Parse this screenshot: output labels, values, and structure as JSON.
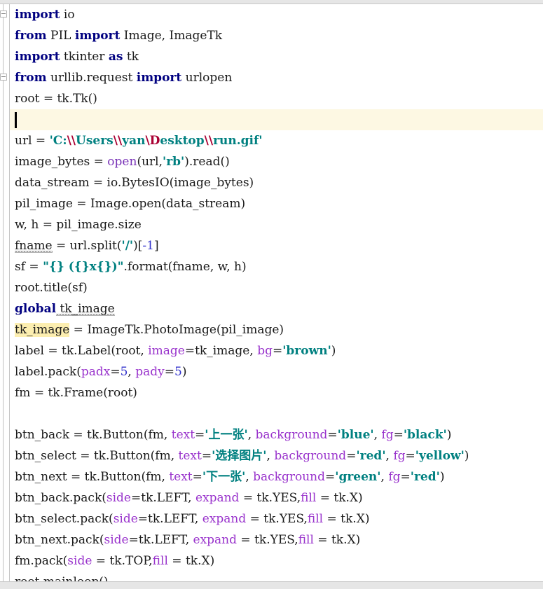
{
  "editor": {
    "language": "python",
    "background_color": "#ffffff",
    "text_color": "#1a1a1a",
    "current_line_color": "#fdf8e3",
    "occurrence_highlight_color": "#fceeb0",
    "keyword_color": "#000080",
    "string_color": "#008080",
    "escape_color": "#aa0033",
    "builtin_color": "#7a34b8",
    "kwarg_color": "#9933cc",
    "number_color": "#3333cc",
    "caret": {
      "line_index": 5,
      "column": 0
    }
  },
  "gutter": {
    "fold_markers": [
      {
        "line_index": 0,
        "state": "expanded",
        "icon": "fold-minus-icon"
      },
      {
        "line_index": 3,
        "state": "expanded",
        "icon": "fold-minus-icon"
      }
    ]
  },
  "code_lines": [
    {
      "index": 0,
      "current": false,
      "tokens": [
        {
          "t": "import",
          "c": "kw"
        },
        {
          "t": " io",
          "c": "plain"
        }
      ]
    },
    {
      "index": 1,
      "current": false,
      "tokens": [
        {
          "t": "from",
          "c": "kw"
        },
        {
          "t": " PIL ",
          "c": "plain"
        },
        {
          "t": "import",
          "c": "kw"
        },
        {
          "t": " Image, ImageTk",
          "c": "plain"
        }
      ]
    },
    {
      "index": 2,
      "current": false,
      "tokens": [
        {
          "t": "import",
          "c": "kw"
        },
        {
          "t": " tkinter ",
          "c": "plain"
        },
        {
          "t": "as",
          "c": "kw"
        },
        {
          "t": " tk",
          "c": "plain"
        }
      ]
    },
    {
      "index": 3,
      "current": false,
      "tokens": [
        {
          "t": "from",
          "c": "kw"
        },
        {
          "t": " urllib.request ",
          "c": "plain"
        },
        {
          "t": "import",
          "c": "kw"
        },
        {
          "t": " urlopen",
          "c": "plain"
        }
      ]
    },
    {
      "index": 4,
      "current": false,
      "tokens": [
        {
          "t": "root = tk.Tk()",
          "c": "plain"
        }
      ]
    },
    {
      "index": 5,
      "current": true,
      "tokens": []
    },
    {
      "index": 6,
      "current": false,
      "tokens": [
        {
          "t": "url = ",
          "c": "plain"
        },
        {
          "t": "'C:",
          "c": "str"
        },
        {
          "t": "\\\\",
          "c": "esc"
        },
        {
          "t": "Users",
          "c": "str"
        },
        {
          "t": "\\\\",
          "c": "esc"
        },
        {
          "t": "yan",
          "c": "str"
        },
        {
          "t": "\\D",
          "c": "esc"
        },
        {
          "t": "esktop",
          "c": "str"
        },
        {
          "t": "\\\\",
          "c": "esc"
        },
        {
          "t": "run.gif'",
          "c": "str"
        }
      ]
    },
    {
      "index": 7,
      "current": false,
      "tokens": [
        {
          "t": "image_bytes = ",
          "c": "plain"
        },
        {
          "t": "open",
          "c": "builtin"
        },
        {
          "t": "(url,",
          "c": "plain"
        },
        {
          "t": "'rb'",
          "c": "str"
        },
        {
          "t": ").read()",
          "c": "plain"
        }
      ]
    },
    {
      "index": 8,
      "current": false,
      "tokens": [
        {
          "t": "data_stream = io.BytesIO(image_bytes)",
          "c": "plain"
        }
      ]
    },
    {
      "index": 9,
      "current": false,
      "tokens": [
        {
          "t": "pil_image = Image.open(data_stream)",
          "c": "plain"
        }
      ]
    },
    {
      "index": 10,
      "current": false,
      "tokens": [
        {
          "t": "w, h = pil_image.size",
          "c": "plain"
        }
      ]
    },
    {
      "index": 11,
      "current": false,
      "tokens": [
        {
          "t": "fname",
          "c": "plain",
          "squiggly": true
        },
        {
          "t": " = url.split(",
          "c": "plain"
        },
        {
          "t": "'/'",
          "c": "str"
        },
        {
          "t": ")[",
          "c": "plain"
        },
        {
          "t": "-1",
          "c": "num"
        },
        {
          "t": "]",
          "c": "plain"
        }
      ]
    },
    {
      "index": 12,
      "current": false,
      "tokens": [
        {
          "t": "sf = ",
          "c": "plain"
        },
        {
          "t": "\"{} ({}x{})\"",
          "c": "str"
        },
        {
          "t": ".format(fname, w, h)",
          "c": "plain"
        }
      ]
    },
    {
      "index": 13,
      "current": false,
      "tokens": [
        {
          "t": "root.title(sf)",
          "c": "plain"
        }
      ]
    },
    {
      "index": 14,
      "current": false,
      "tokens": [
        {
          "t": "global",
          "c": "kw"
        },
        {
          "t": " tk_image",
          "c": "plain",
          "squiggly": true
        }
      ]
    },
    {
      "index": 15,
      "current": false,
      "tokens": [
        {
          "t": "tk_image",
          "c": "plain",
          "occurrence": true
        },
        {
          "t": " = ImageTk.PhotoImage(pil_image)",
          "c": "plain"
        }
      ]
    },
    {
      "index": 16,
      "current": false,
      "tokens": [
        {
          "t": "label = tk.Label(root, ",
          "c": "plain"
        },
        {
          "t": "image",
          "c": "kwarg"
        },
        {
          "t": "=tk_image, ",
          "c": "plain"
        },
        {
          "t": "bg",
          "c": "kwarg"
        },
        {
          "t": "=",
          "c": "plain"
        },
        {
          "t": "'brown'",
          "c": "str"
        },
        {
          "t": ")",
          "c": "plain"
        }
      ]
    },
    {
      "index": 17,
      "current": false,
      "tokens": [
        {
          "t": "label.pack(",
          "c": "plain"
        },
        {
          "t": "padx",
          "c": "kwarg"
        },
        {
          "t": "=",
          "c": "plain"
        },
        {
          "t": "5",
          "c": "num"
        },
        {
          "t": ", ",
          "c": "plain"
        },
        {
          "t": "pady",
          "c": "kwarg"
        },
        {
          "t": "=",
          "c": "plain"
        },
        {
          "t": "5",
          "c": "num"
        },
        {
          "t": ")",
          "c": "plain"
        }
      ]
    },
    {
      "index": 18,
      "current": false,
      "tokens": [
        {
          "t": "fm = tk.Frame(root)",
          "c": "plain"
        }
      ]
    },
    {
      "index": 19,
      "current": false,
      "tokens": []
    },
    {
      "index": 20,
      "current": false,
      "tokens": [
        {
          "t": "btn_back = tk.Button(fm, ",
          "c": "plain"
        },
        {
          "t": "text",
          "c": "kwarg"
        },
        {
          "t": "=",
          "c": "plain"
        },
        {
          "t": "'上一张'",
          "c": "str"
        },
        {
          "t": ", ",
          "c": "plain"
        },
        {
          "t": "background",
          "c": "kwarg"
        },
        {
          "t": "=",
          "c": "plain"
        },
        {
          "t": "'blue'",
          "c": "str"
        },
        {
          "t": ", ",
          "c": "plain"
        },
        {
          "t": "fg",
          "c": "kwarg"
        },
        {
          "t": "=",
          "c": "plain"
        },
        {
          "t": "'black'",
          "c": "str"
        },
        {
          "t": ")",
          "c": "plain"
        }
      ]
    },
    {
      "index": 21,
      "current": false,
      "tokens": [
        {
          "t": "btn_select = tk.Button(fm, ",
          "c": "plain"
        },
        {
          "t": "text",
          "c": "kwarg"
        },
        {
          "t": "=",
          "c": "plain"
        },
        {
          "t": "'选择图片'",
          "c": "str"
        },
        {
          "t": ", ",
          "c": "plain"
        },
        {
          "t": "background",
          "c": "kwarg"
        },
        {
          "t": "=",
          "c": "plain"
        },
        {
          "t": "'red'",
          "c": "str"
        },
        {
          "t": ", ",
          "c": "plain"
        },
        {
          "t": "fg",
          "c": "kwarg"
        },
        {
          "t": "=",
          "c": "plain"
        },
        {
          "t": "'yellow'",
          "c": "str"
        },
        {
          "t": ")",
          "c": "plain"
        }
      ]
    },
    {
      "index": 22,
      "current": false,
      "tokens": [
        {
          "t": "btn_next = tk.Button(fm, ",
          "c": "plain"
        },
        {
          "t": "text",
          "c": "kwarg"
        },
        {
          "t": "=",
          "c": "plain"
        },
        {
          "t": "'下一张'",
          "c": "str"
        },
        {
          "t": ", ",
          "c": "plain"
        },
        {
          "t": "background",
          "c": "kwarg"
        },
        {
          "t": "=",
          "c": "plain"
        },
        {
          "t": "'green'",
          "c": "str"
        },
        {
          "t": ", ",
          "c": "plain"
        },
        {
          "t": "fg",
          "c": "kwarg"
        },
        {
          "t": "=",
          "c": "plain"
        },
        {
          "t": "'red'",
          "c": "str"
        },
        {
          "t": ")",
          "c": "plain"
        }
      ]
    },
    {
      "index": 23,
      "current": false,
      "tokens": [
        {
          "t": "btn_back.pack(",
          "c": "plain"
        },
        {
          "t": "side",
          "c": "kwarg"
        },
        {
          "t": "=tk.LEFT, ",
          "c": "plain"
        },
        {
          "t": "expand",
          "c": "kwarg"
        },
        {
          "t": " = tk.YES,",
          "c": "plain"
        },
        {
          "t": "fill",
          "c": "kwarg"
        },
        {
          "t": " = tk.X)",
          "c": "plain"
        }
      ]
    },
    {
      "index": 24,
      "current": false,
      "tokens": [
        {
          "t": "btn_select.pack(",
          "c": "plain"
        },
        {
          "t": "side",
          "c": "kwarg"
        },
        {
          "t": "=tk.LEFT, ",
          "c": "plain"
        },
        {
          "t": "expand",
          "c": "kwarg"
        },
        {
          "t": " = tk.YES,",
          "c": "plain"
        },
        {
          "t": "fill",
          "c": "kwarg"
        },
        {
          "t": " = tk.X)",
          "c": "plain"
        }
      ]
    },
    {
      "index": 25,
      "current": false,
      "tokens": [
        {
          "t": "btn_next.pack(",
          "c": "plain"
        },
        {
          "t": "side",
          "c": "kwarg"
        },
        {
          "t": "=tk.LEFT, ",
          "c": "plain"
        },
        {
          "t": "expand",
          "c": "kwarg"
        },
        {
          "t": " = tk.YES,",
          "c": "plain"
        },
        {
          "t": "fill",
          "c": "kwarg"
        },
        {
          "t": " = tk.X)",
          "c": "plain"
        }
      ]
    },
    {
      "index": 26,
      "current": false,
      "tokens": [
        {
          "t": "fm.pack(",
          "c": "plain"
        },
        {
          "t": "side",
          "c": "kwarg"
        },
        {
          "t": " = tk.TOP,",
          "c": "plain"
        },
        {
          "t": "fill",
          "c": "kwarg"
        },
        {
          "t": " = tk.X)",
          "c": "plain"
        }
      ]
    },
    {
      "index": 27,
      "current": false,
      "tokens": [
        {
          "t": "root.mainloop()",
          "c": "plain"
        }
      ]
    }
  ]
}
